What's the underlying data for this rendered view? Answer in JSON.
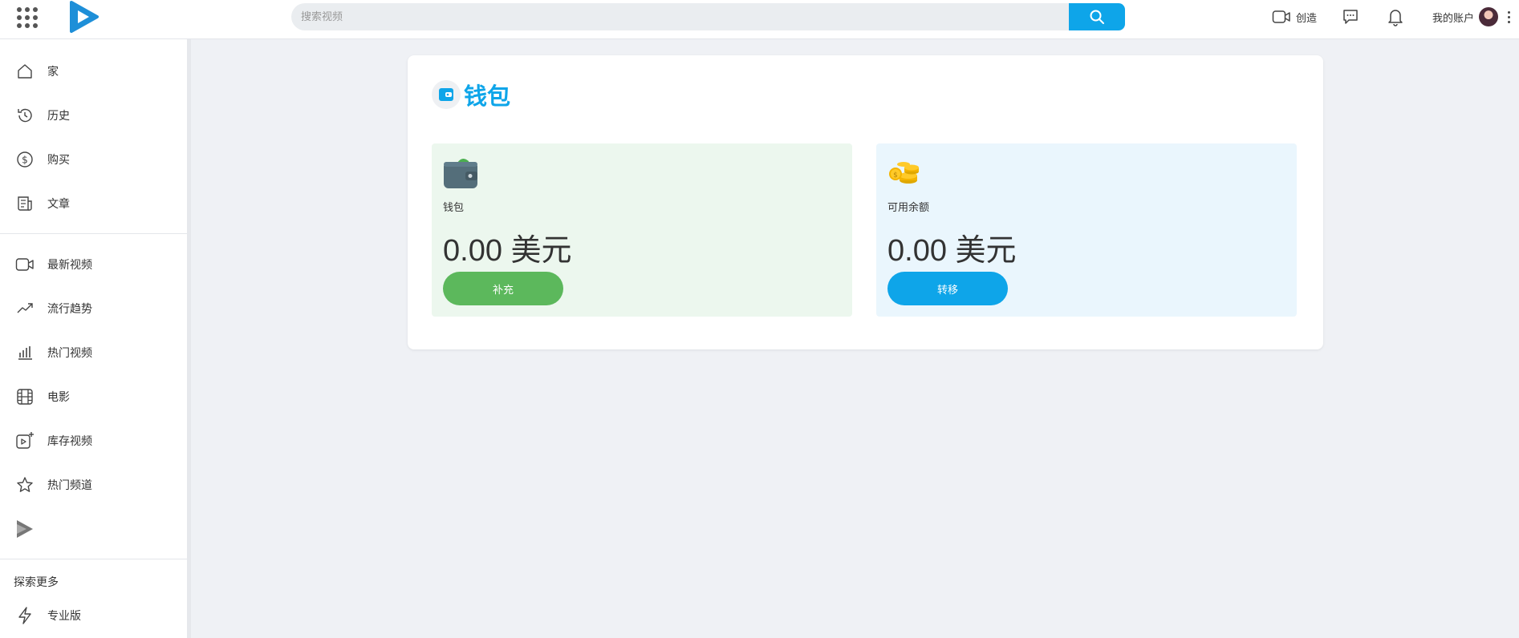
{
  "header": {
    "search_placeholder": "搜索视频",
    "create_label": "创造",
    "account_label": "我的账户"
  },
  "sidebar": {
    "group1": [
      {
        "label": "家",
        "icon": "home-icon"
      },
      {
        "label": "历史",
        "icon": "history-icon"
      },
      {
        "label": "购买",
        "icon": "dollar-icon"
      },
      {
        "label": "文章",
        "icon": "article-icon"
      }
    ],
    "group2": [
      {
        "label": "最新视频",
        "icon": "video-camera-icon"
      },
      {
        "label": "流行趋势",
        "icon": "trending-icon"
      },
      {
        "label": "热门视频",
        "icon": "bar-chart-icon"
      },
      {
        "label": "电影",
        "icon": "film-icon"
      },
      {
        "label": "库存视频",
        "icon": "add-video-icon"
      },
      {
        "label": "热门频道",
        "icon": "star-icon"
      }
    ],
    "explore_title": "探索更多",
    "pro_label": "专业版"
  },
  "wallet": {
    "title": "钱包",
    "wallet_panel": {
      "label": "钱包",
      "amount": "0.00 美元",
      "button_label": "补充"
    },
    "balance_panel": {
      "label": "可用余额",
      "amount": "0.00 美元",
      "button_label": "转移"
    }
  },
  "colors": {
    "accent": "#0ea5e9",
    "green": "#5cb85c"
  }
}
